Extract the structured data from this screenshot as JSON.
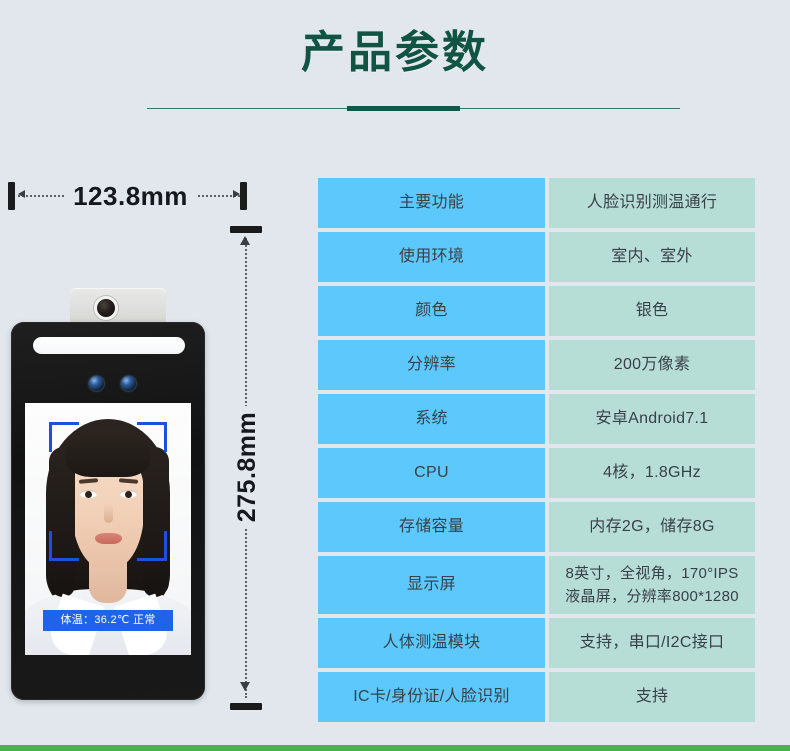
{
  "header": {
    "title": "产品参数"
  },
  "device": {
    "width_label": "123.8mm",
    "height_label": "275.8mm",
    "screen_banner": "体温：36.2℃  正常"
  },
  "spec_table": {
    "rows": [
      {
        "key": "主要功能",
        "value": "人脸识别测温通行"
      },
      {
        "key": "使用环境",
        "value": "室内、室外"
      },
      {
        "key": "颜色",
        "value": "银色"
      },
      {
        "key": "分辨率",
        "value": "200万像素"
      },
      {
        "key": "系统",
        "value": "安卓Android7.1"
      },
      {
        "key": "CPU",
        "value": "4核，1.8GHz"
      },
      {
        "key": "存储容量",
        "value": "内存2G，储存8G"
      },
      {
        "key": "显示屏",
        "value": "8英寸，全视角，170°IPS\n液晶屏，分辨率800*1280"
      },
      {
        "key": "人体测温模块",
        "value": "支持，串口/I2C接口"
      },
      {
        "key": "IC卡/身份证/人脸识别",
        "value": "支持"
      }
    ]
  },
  "colors": {
    "background": "#e2e7ed",
    "title_green": "#115444",
    "divider_green": "#12574a",
    "key_cell_blue": "#5cc8fb",
    "value_cell_teal": "#b6ded6",
    "cell_text": "#3a4048",
    "banner_blue": "#1f63e8",
    "face_frame_blue": "#1f4fe0",
    "bottom_strip_green": "#4caf50"
  }
}
